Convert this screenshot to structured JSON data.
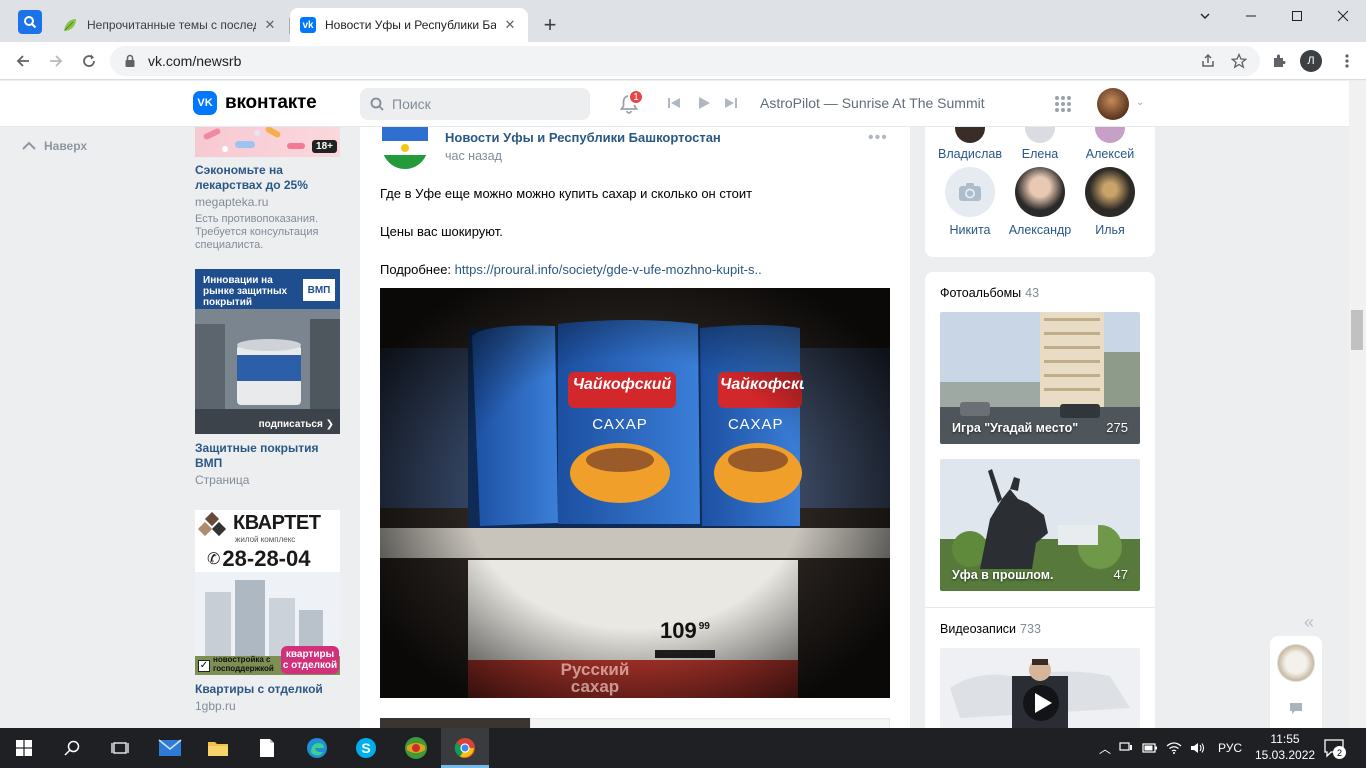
{
  "browser": {
    "tabs": [
      {
        "title": "Непрочитанные темы с последн",
        "active": false
      },
      {
        "title": "Новости Уфы и Республики Баш",
        "active": true
      }
    ],
    "url": "vk.com/newsrb",
    "profile_initial": "Л"
  },
  "vk": {
    "logo_text": "вконтакте",
    "search_placeholder": "Поиск",
    "notifications_count": "1",
    "now_playing": "AstroPilot — Sunrise At The Summit",
    "nav_up": "Наверх"
  },
  "ads": [
    {
      "badge": "18+",
      "title": "Сэкономьте на лекарствах до 25%",
      "source": "megapteka.ru",
      "disclaimer": "Есть противопоказания. Требуется консультация специалиста."
    },
    {
      "banner": "Инновации на рынке защитных покрытий",
      "logo": "ВМП",
      "subscribe": "подписаться",
      "title": "Защитные покрытия ВМП",
      "source": "Страница"
    },
    {
      "brand": "КВАРТЕТ",
      "tagline": "жилой комплекс",
      "phone": "28-28-04",
      "note": "новостройка с господдержкой",
      "badge_line1": "квартиры",
      "badge_line2": "с отделкой",
      "title": "Квартиры с отделкой",
      "source": "1gbp.ru"
    }
  ],
  "post": {
    "author": "Новости Уфы и Республики Башкортостан",
    "time": "час назад",
    "line1": "Где в Уфе еще можно можно купить сахар и сколько он стоит",
    "line2": "Цены вас шокируют.",
    "more_label": "Подробнее: ",
    "link": "https://proural.info/society/gde-v-ufe-mozhno-kupit-s..",
    "photo": {
      "brand": "Чайкофский",
      "product": "САХАР",
      "price_main": "109",
      "price_cents": "99",
      "bg_text_1": "Русский",
      "bg_text_2": "сахар"
    }
  },
  "friends": [
    {
      "name": "Владислав"
    },
    {
      "name": "Елена"
    },
    {
      "name": "Алексей"
    },
    {
      "name": "Никита"
    },
    {
      "name": "Александр"
    },
    {
      "name": "Илья"
    }
  ],
  "albums": {
    "label": "Фотоальбомы",
    "count": "43",
    "items": [
      {
        "caption": "Игра \"Угадай место\"",
        "count": "275"
      },
      {
        "caption": "Уфа в прошлом.",
        "count": "47"
      }
    ]
  },
  "videos": {
    "label": "Видеозаписи",
    "count": "733"
  },
  "taskbar": {
    "lang": "РУС",
    "time": "11:55",
    "date": "15.03.2022",
    "notif_count": "2"
  },
  "colors": {
    "vk_blue": "#0077ff",
    "link": "#2a5885",
    "page_bg": "#edeef0",
    "taskbar": "#1f2023"
  }
}
